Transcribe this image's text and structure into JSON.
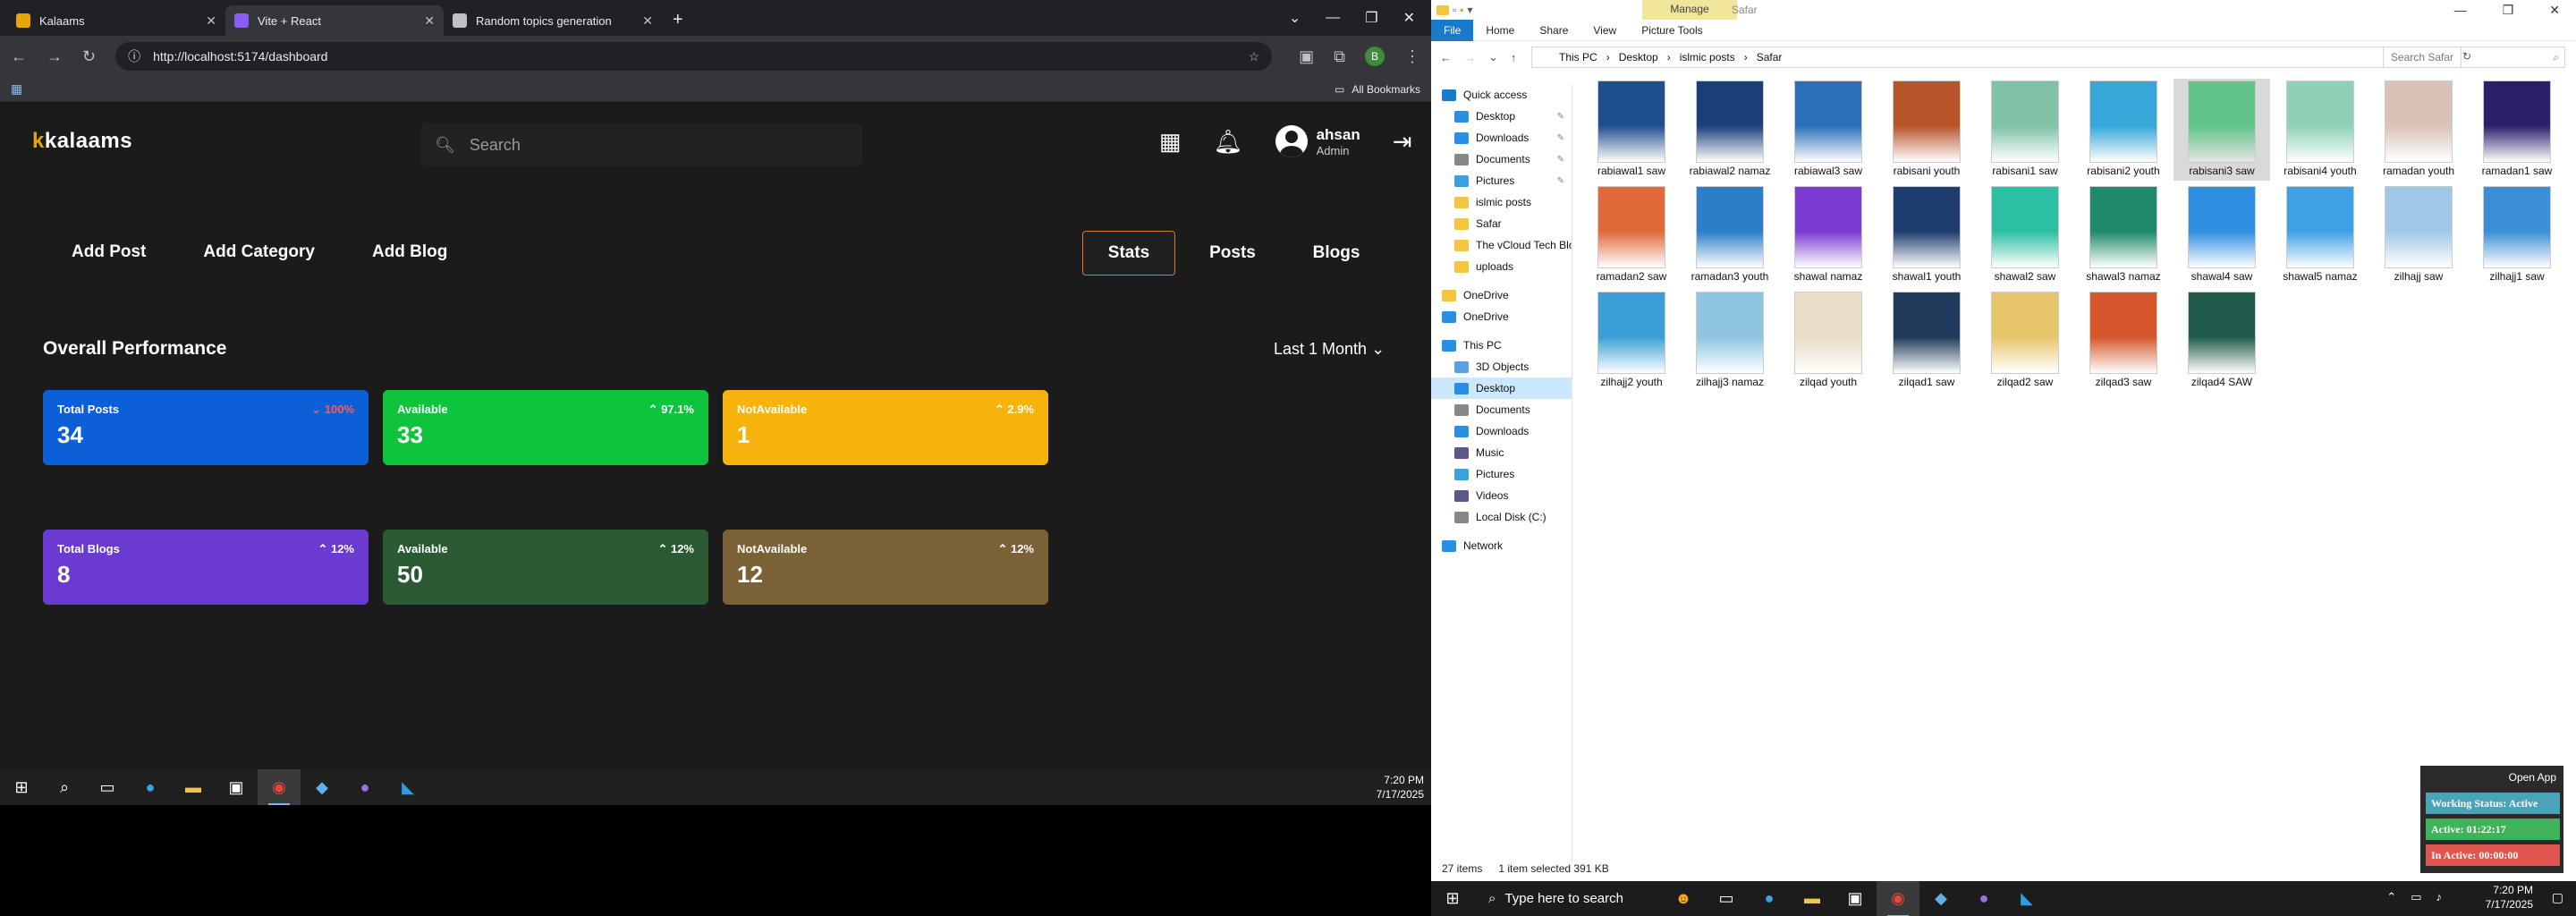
{
  "browser": {
    "tabs": [
      {
        "title": "Kalaams",
        "active": false,
        "color": "#e6a500"
      },
      {
        "title": "Vite + React",
        "active": true,
        "color": "#8b5cf6"
      },
      {
        "title": "Random topics generation",
        "active": false,
        "color": "#bdc1c6"
      }
    ],
    "url": "http://localhost:5174/dashboard",
    "all_bookmarks": "All Bookmarks",
    "profile_initial": "B"
  },
  "app": {
    "logo_mark": "k",
    "logo_rest": "kalaams",
    "search_placeholder": "Search",
    "user": {
      "name": "ahsan",
      "role": "Admin"
    },
    "actions": [
      "Add Post",
      "Add Category",
      "Add Blog"
    ],
    "view_tabs": [
      {
        "label": "Stats",
        "selected": true
      },
      {
        "label": "Posts",
        "selected": false
      },
      {
        "label": "Blogs",
        "selected": false
      }
    ],
    "section_title": "Overall Performance",
    "range": "Last 1 Month",
    "cards": [
      {
        "label": "Total Posts",
        "value": "34",
        "change": "100%",
        "negative": true,
        "color": "#0d5fd8"
      },
      {
        "label": "Available",
        "value": "33",
        "change": "97.1%",
        "negative": false,
        "color": "#0ec43c"
      },
      {
        "label": "NotAvailable",
        "value": "1",
        "change": "2.9%",
        "negative": false,
        "color": "#f5b30b"
      },
      {
        "label": "Total Blogs",
        "value": "8",
        "change": "12%",
        "negative": false,
        "color": "#6b3bd1"
      },
      {
        "label": "Available",
        "value": "50",
        "change": "12%",
        "negative": false,
        "color": "#2a5a32"
      },
      {
        "label": "NotAvailable",
        "value": "12",
        "change": "12%",
        "negative": false,
        "color": "#7a6236"
      }
    ]
  },
  "taskbar_left": {
    "time": "7:20 PM",
    "date": "7/17/2025"
  },
  "explorer": {
    "manage": "Manage",
    "folder_title": "Safar",
    "ribbon_tabs": [
      "File",
      "Home",
      "Share",
      "View",
      "Picture Tools"
    ],
    "breadcrumb": [
      "This PC",
      "Desktop",
      "islmic posts",
      "Safar"
    ],
    "search_placeholder": "Search Safar",
    "nav": [
      {
        "label": "Quick access",
        "icon": "star",
        "indent": 0,
        "pinned": false
      },
      {
        "label": "Desktop",
        "icon": "desktop",
        "indent": 1,
        "pinned": true
      },
      {
        "label": "Downloads",
        "icon": "download",
        "indent": 1,
        "pinned": true
      },
      {
        "label": "Documents",
        "icon": "document",
        "indent": 1,
        "pinned": true
      },
      {
        "label": "Pictures",
        "icon": "picture",
        "indent": 1,
        "pinned": true
      },
      {
        "label": "islmic posts",
        "icon": "folder",
        "indent": 1,
        "pinned": false
      },
      {
        "label": "Safar",
        "icon": "folder",
        "indent": 1,
        "pinned": false
      },
      {
        "label": "The vCloud Tech Blo",
        "icon": "folder",
        "indent": 1,
        "pinned": false
      },
      {
        "label": "uploads",
        "icon": "folder",
        "indent": 1,
        "pinned": false
      },
      {
        "label": "OneDrive",
        "icon": "folder",
        "indent": 0,
        "pinned": false
      },
      {
        "label": "OneDrive",
        "icon": "cloud",
        "indent": 0,
        "pinned": false
      },
      {
        "label": "This PC",
        "icon": "pc",
        "indent": 0,
        "pinned": false
      },
      {
        "label": "3D Objects",
        "icon": "cube",
        "indent": 1,
        "pinned": false
      },
      {
        "label": "Desktop",
        "icon": "desktop",
        "indent": 1,
        "pinned": false,
        "selected": true
      },
      {
        "label": "Documents",
        "icon": "document",
        "indent": 1,
        "pinned": false
      },
      {
        "label": "Downloads",
        "icon": "download",
        "indent": 1,
        "pinned": false
      },
      {
        "label": "Music",
        "icon": "music",
        "indent": 1,
        "pinned": false
      },
      {
        "label": "Pictures",
        "icon": "picture",
        "indent": 1,
        "pinned": false
      },
      {
        "label": "Videos",
        "icon": "video",
        "indent": 1,
        "pinned": false
      },
      {
        "label": "Local Disk (C:)",
        "icon": "drive",
        "indent": 1,
        "pinned": false
      },
      {
        "label": "Network",
        "icon": "network",
        "indent": 0,
        "pinned": false
      }
    ],
    "files": [
      {
        "name": "rabiawal1 saw",
        "color": "#1f4f8f"
      },
      {
        "name": "rabiawal2 namaz",
        "color": "#1a3f7a"
      },
      {
        "name": "rabiawal3 saw",
        "color": "#2a6fb8"
      },
      {
        "name": "rabisani youth",
        "color": "#b8542a"
      },
      {
        "name": "rabisani1 saw",
        "color": "#7fc2a6"
      },
      {
        "name": "rabisani2 youth",
        "color": "#37a6d9"
      },
      {
        "name": "rabisani3 saw",
        "color": "#5fc486",
        "selected": true
      },
      {
        "name": "rabisani4 youth",
        "color": "#8fd1b5"
      },
      {
        "name": "ramadan youth",
        "color": "#d9c3b8"
      },
      {
        "name": "ramadan1 saw",
        "color": "#2a1f6b"
      },
      {
        "name": "ramadan2 saw",
        "color": "#e0693a"
      },
      {
        "name": "ramadan3 youth",
        "color": "#2b7fc9"
      },
      {
        "name": "shawal namaz",
        "color": "#7b3ad1"
      },
      {
        "name": "shawal1 youth",
        "color": "#1f3d6e"
      },
      {
        "name": "shawal2 saw",
        "color": "#2bbfa3"
      },
      {
        "name": "shawal3 namaz",
        "color": "#1f8a6b"
      },
      {
        "name": "shawal4 saw",
        "color": "#2f8fe0"
      },
      {
        "name": "shawal5 namaz",
        "color": "#3fa0e6"
      },
      {
        "name": "zilhajj saw",
        "color": "#a0c8e6"
      },
      {
        "name": "zilhajj1 saw",
        "color": "#3a8fd6"
      },
      {
        "name": "zilhajj2 youth",
        "color": "#3a9fd6"
      },
      {
        "name": "zilhajj3 namaz",
        "color": "#8ec4e0"
      },
      {
        "name": "zilqad youth",
        "color": "#e8ddc6"
      },
      {
        "name": "zilqad1 saw",
        "color": "#1f3a5a"
      },
      {
        "name": "zilqad2 saw",
        "color": "#e6c56b"
      },
      {
        "name": "zilqad3 saw",
        "color": "#d4562a"
      },
      {
        "name": "zilqad4 SAW",
        "color": "#1f5a4a"
      }
    ],
    "status": {
      "count": "27 items",
      "selection": "1 item selected  391 KB"
    }
  },
  "widget": {
    "open_app": "Open App",
    "working_status": "Working Status: Active",
    "active": "Active: 01:22:17",
    "inactive": "In Active: 00:00:00"
  },
  "taskbar_right": {
    "search_placeholder": "Type here to search",
    "time": "7:20 PM",
    "date": "7/17/2025"
  }
}
